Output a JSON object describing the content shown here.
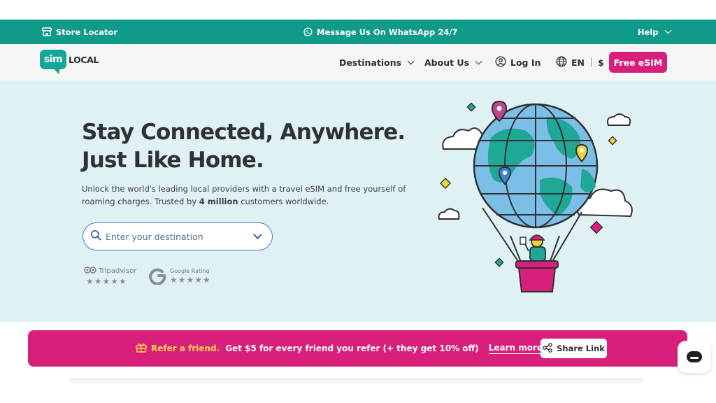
{
  "topbar": {
    "store_locator": "Store Locator",
    "whatsapp": "Message Us On WhatsApp 24/7",
    "help": "Help"
  },
  "nav": {
    "logo_left": "sim",
    "logo_right": "LOCAL",
    "destinations": "Destinations",
    "about": "About Us",
    "login": "Log In",
    "language": "EN",
    "currency": "$",
    "cta": "Free eSIM"
  },
  "hero": {
    "title_line1": "Stay Connected, Anywhere.",
    "title_line2": "Just Like Home.",
    "subtitle_pre": "Unlock the world's leading local providers with a travel eSIM and free yourself of roaming charges. Trusted by ",
    "subtitle_bold": "4 million",
    "subtitle_post": " customers worldwide.",
    "search_placeholder": "Enter your destination",
    "tripadvisor_label": "Tripadvisor",
    "google_label": "Google Rating",
    "stars": "★★★★★"
  },
  "promo": {
    "refer": "Refer a friend.",
    "offer": "Get $5 for every friend you refer  (+ they get 10% off)",
    "learn_more": "Learn more",
    "share": "Share Link"
  },
  "colors": {
    "teal": "#0f9a8a",
    "magenta": "#d81f7b",
    "hero_bg": "#dff1f2",
    "yellow": "#ffd84a"
  }
}
